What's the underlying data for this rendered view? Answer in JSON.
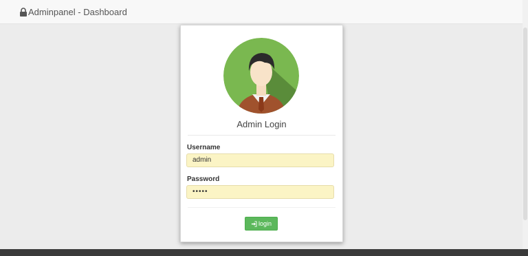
{
  "navbar": {
    "brand_icon": "lock-icon",
    "title": "Adminpanel - Dashboard"
  },
  "login": {
    "heading": "Admin Login",
    "avatar_icon": "user-avatar",
    "username_label": "Username",
    "username_value": "admin",
    "password_label": "Password",
    "password_value": "•••••",
    "button_icon": "sign-in-icon",
    "button_label": "login"
  },
  "colors": {
    "accent_button": "#5cb85c",
    "avatar_bg": "#7ab850",
    "field_bg": "#fbf4c5"
  }
}
